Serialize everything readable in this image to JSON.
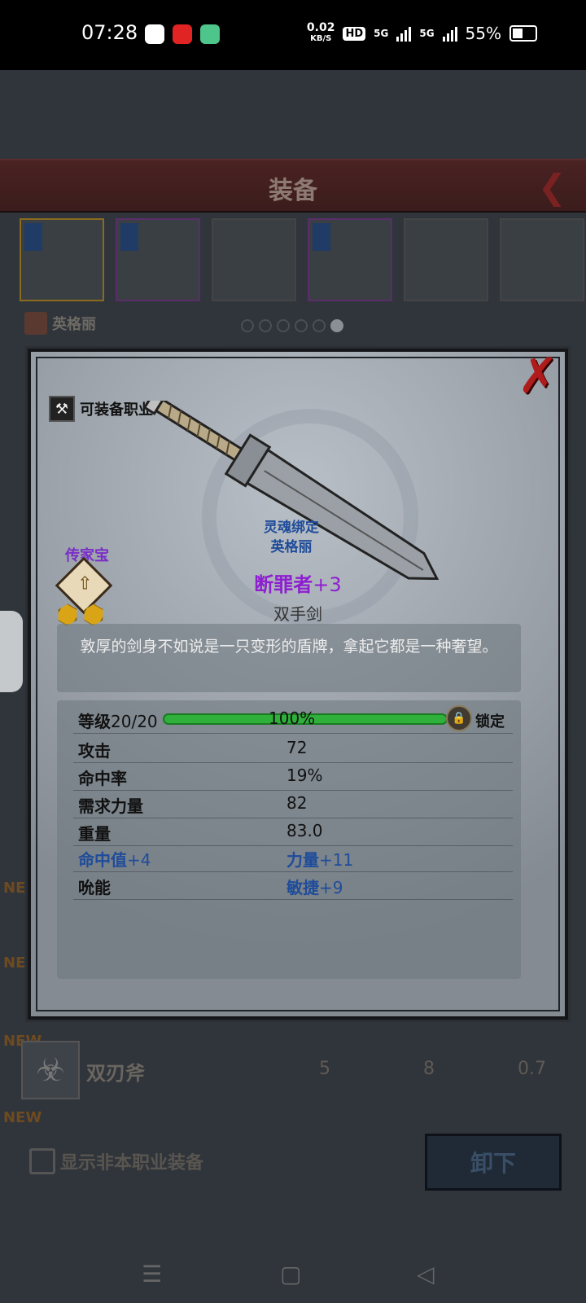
{
  "status": {
    "time": "07:28",
    "net_speed": "0.02",
    "net_unit": "KB/S",
    "hd": "HD",
    "sig1": "5G",
    "sig2": "5G",
    "battery": "55%"
  },
  "header": {
    "title": "装备"
  },
  "owner_name": "英格丽",
  "pager": {
    "count": 6,
    "active": 6
  },
  "list": {
    "new_tag": "NEW",
    "row": {
      "name": "双刃斧",
      "v1": "5",
      "v2": "8",
      "v3": "0.7"
    }
  },
  "footer": {
    "checkbox_label": "显示非本职业装备",
    "unequip_label": "卸下"
  },
  "modal": {
    "class_label": "可装备职业",
    "heirloom_label": "传家宝",
    "soulbound_line1": "灵魂绑定",
    "soulbound_line2": "英格丽",
    "item_name": "断罪者",
    "item_plus": "+3",
    "item_type": "双手剑",
    "description": "敦厚的剑身不如说是一只变形的盾牌，拿起它都是一种奢望。",
    "level_label": "等级",
    "level_value": "20/20",
    "progress_text": "100%",
    "progress": 1.0,
    "lock_label": "锁定",
    "stats": [
      {
        "k": "攻击",
        "v": "72"
      },
      {
        "k": "命中率",
        "v": "19%"
      },
      {
        "k": "需求力量",
        "v": "82"
      },
      {
        "k": "重量",
        "v": "83.0"
      }
    ],
    "bonus": [
      {
        "k_name": "命中值",
        "k_plus": "+4",
        "v_name": "力量",
        "v_plus": "+11"
      },
      {
        "k_name": "吮能",
        "k_plus": "",
        "v_name": "敏捷",
        "v_plus": "+9"
      }
    ]
  },
  "colors": {
    "legendary": "#8e1fd0",
    "bonus": "#1f4c9a",
    "progress": "#2fb03a",
    "close": "#b01b1b"
  }
}
